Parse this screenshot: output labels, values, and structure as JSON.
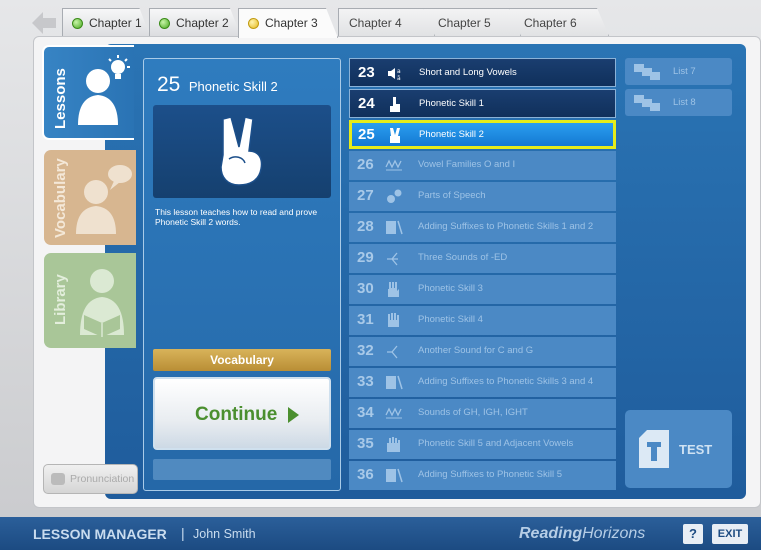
{
  "tabs": [
    {
      "label": "Chapter 1",
      "status": "complete"
    },
    {
      "label": "Chapter 2",
      "status": "complete"
    },
    {
      "label": "Chapter 3",
      "status": "in-progress"
    },
    {
      "label": "Chapter 4",
      "status": "none"
    },
    {
      "label": "Chapter 5",
      "status": "none"
    },
    {
      "label": "Chapter 6",
      "status": "none"
    }
  ],
  "sidebar": {
    "lessons": "Lessons",
    "vocabulary": "Vocabulary",
    "library": "Library",
    "pronunciation": "Pronunciation"
  },
  "detail": {
    "number": "25",
    "name": "Phonetic Skill 2",
    "description": "This lesson teaches how to read and prove Phonetic Skill 2 words.",
    "vocabulary_label": "Vocabulary",
    "continue_label": "Continue"
  },
  "lessons": [
    {
      "num": "23",
      "title": "Short and Long Vowels",
      "state": "done",
      "icon": "vowel-sound-icon"
    },
    {
      "num": "24",
      "title": "Phonetic Skill 1",
      "state": "done",
      "icon": "one-finger-hand-icon"
    },
    {
      "num": "25",
      "title": "Phonetic Skill 2",
      "state": "current",
      "icon": "two-finger-hand-icon"
    },
    {
      "num": "26",
      "title": "Vowel Families O and I",
      "state": "locked",
      "icon": "vowel-family-icon"
    },
    {
      "num": "27",
      "title": "Parts of Speech",
      "state": "locked",
      "icon": "gears-icon"
    },
    {
      "num": "28",
      "title": "Adding Suffixes to Phonetic Skills 1 and 2",
      "state": "locked",
      "icon": "suffix-icon"
    },
    {
      "num": "29",
      "title": "Three Sounds of -ED",
      "state": "locked",
      "icon": "sound-branch-icon"
    },
    {
      "num": "30",
      "title": "Phonetic Skill 3",
      "state": "locked",
      "icon": "three-finger-hand-icon"
    },
    {
      "num": "31",
      "title": "Phonetic Skill 4",
      "state": "locked",
      "icon": "four-finger-hand-icon"
    },
    {
      "num": "32",
      "title": "Another Sound for C and G",
      "state": "locked",
      "icon": "sound-branch-icon"
    },
    {
      "num": "33",
      "title": "Adding Suffixes to Phonetic Skills 3 and 4",
      "state": "locked",
      "icon": "suffix-icon"
    },
    {
      "num": "34",
      "title": "Sounds of GH, IGH, IGHT",
      "state": "locked",
      "icon": "vowel-family-icon"
    },
    {
      "num": "35",
      "title": "Phonetic Skill 5 and Adjacent Vowels",
      "state": "locked",
      "icon": "open-hand-icon"
    },
    {
      "num": "36",
      "title": "Adding Suffixes to Phonetic Skill 5",
      "state": "locked",
      "icon": "suffix-icon"
    }
  ],
  "lists": [
    {
      "label": "List 7"
    },
    {
      "label": "List 8"
    }
  ],
  "test_label": "TEST",
  "bottom": {
    "title": "LESSON MANAGER",
    "separator": "|",
    "user": "John Smith",
    "brand_bold": "Reading",
    "brand_light": "Horizons",
    "help": "?",
    "exit": "EXIT"
  },
  "colors": {
    "panel_blue": "#2568a8",
    "current_highlight": "#e6ec1a",
    "continue_green": "#4b8f2f",
    "vocab_gold": "#c9a048"
  }
}
